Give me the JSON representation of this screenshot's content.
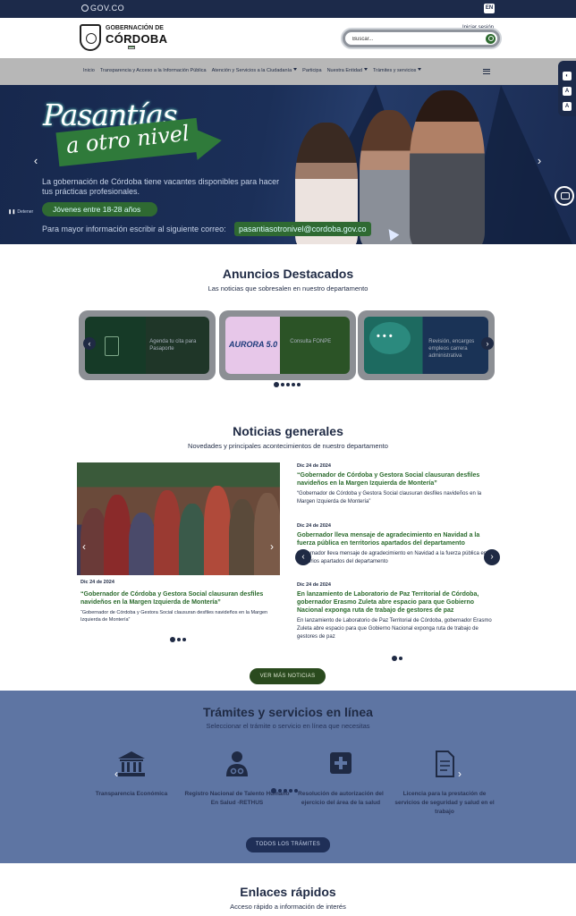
{
  "govbar": {
    "logo": "GOV.CO",
    "lang": "EN"
  },
  "header": {
    "brand_line1": "GOBERNACIÓN DE",
    "brand_line2": "CÓRDOBA",
    "login": "Iniciar sesión",
    "search_placeholder": "Buscar..."
  },
  "nav": {
    "items": [
      {
        "label": "Inicio",
        "dropdown": false
      },
      {
        "label": "Transparencia y Acceso a la Información Pública",
        "dropdown": false
      },
      {
        "label": "Atención y Servicios a la Ciudadanía",
        "dropdown": true
      },
      {
        "label": "Participa",
        "dropdown": false
      },
      {
        "label": "Nuestra Entidad",
        "dropdown": true
      },
      {
        "label": "Trámites y servicios",
        "dropdown": true
      }
    ]
  },
  "hero": {
    "title_line1": "Pasantías",
    "title_line2": "a otro nivel",
    "description": "La gobernación de Córdoba tiene vacantes disponibles para hacer tus prácticas profesionales.",
    "age_tag": "Jóvenes entre 18-28 años",
    "mail_text": "Para mayor información escribir al siguiente correo:",
    "mail": "pasantiasotronivel@cordoba.gov.co",
    "pause_label": "Detener"
  },
  "anuncios": {
    "title": "Anuncios Destacados",
    "subtitle": "Las noticias que sobresalen en nuestro departamento",
    "cards": [
      {
        "text": "Agenda tu cita para Pasaporte"
      },
      {
        "text": "Consulta FONPE",
        "logo": "AURORA 5.0"
      },
      {
        "text": "Revisión, encargos empleos carrera administrativa"
      }
    ],
    "dot_count": 5
  },
  "noticias": {
    "title": "Noticias generales",
    "subtitle": "Novedades y principales acontecimientos de nuestro departamento",
    "featured": {
      "date": "Dic 24 de 2024",
      "headline": "“Gobernador de Córdoba y Gestora Social clausuran desfiles navideños en la Margen Izquierda de Montería”",
      "summary": "“Gobernador de Córdoba y Gestora Social clausuran desfiles navideños en la Margen Izquierda de Montería”"
    },
    "list": [
      {
        "date": "Dic 24 de 2024",
        "headline": "“Gobernador de Córdoba y Gestora Social clausuran desfiles navideños en la Margen Izquierda de Montería”",
        "summary": "“Gobernador de Córdoba y Gestora Social clausuran desfiles navideños en la Margen Izquierda de Montería”"
      },
      {
        "date": "Dic 24 de 2024",
        "headline": "Gobernador lleva mensaje de agradecimiento en Navidad a la fuerza pública en territorios apartados del departamento",
        "summary": "Gobernador lleva mensaje de agradecimiento en Navidad a la fuerza pública en territorios apartados del departamento"
      },
      {
        "date": "Dic 24 de 2024",
        "headline": "En lanzamiento de Laboratorio de Paz Territorial de Córdoba, gobernador Erasmo Zuleta abre espacio para que Gobierno Nacional exponga ruta de trabajo de gestores de paz",
        "summary": "En lanzamiento de Laboratorio de Paz Territorial de Córdoba, gobernador Erasmo Zuleta abre espacio para que Gobierno Nacional exponga ruta de trabajo de gestores de paz"
      }
    ],
    "more_button": "VER MÁS NOTICIAS"
  },
  "tramites": {
    "title": "Trámites y servicios en línea",
    "subtitle": "Seleccionar el trámite o servicio en línea que necesitas",
    "items": [
      {
        "label": "Transparencia Económica",
        "icon": "bank-icon"
      },
      {
        "label": "Registro Nacional de Talento Humano En Salud -RETHUS",
        "icon": "doctor-icon"
      },
      {
        "label": "Resolución de autorización del ejercicio del área de la salud",
        "icon": "medical-cross-icon"
      },
      {
        "label": "Licencia para la prestación de servicios de seguridad y salud en el trabajo",
        "icon": "document-icon"
      }
    ],
    "all_button": "TODOS LOS TRÁMITES"
  },
  "enlaces": {
    "title": "Enlaces rápidos",
    "subtitle": "Acceso rápido a información de interés"
  },
  "colors": {
    "navy": "#1c2a4a",
    "green": "#2f6a32",
    "tramites_bg": "#5e75a3"
  }
}
